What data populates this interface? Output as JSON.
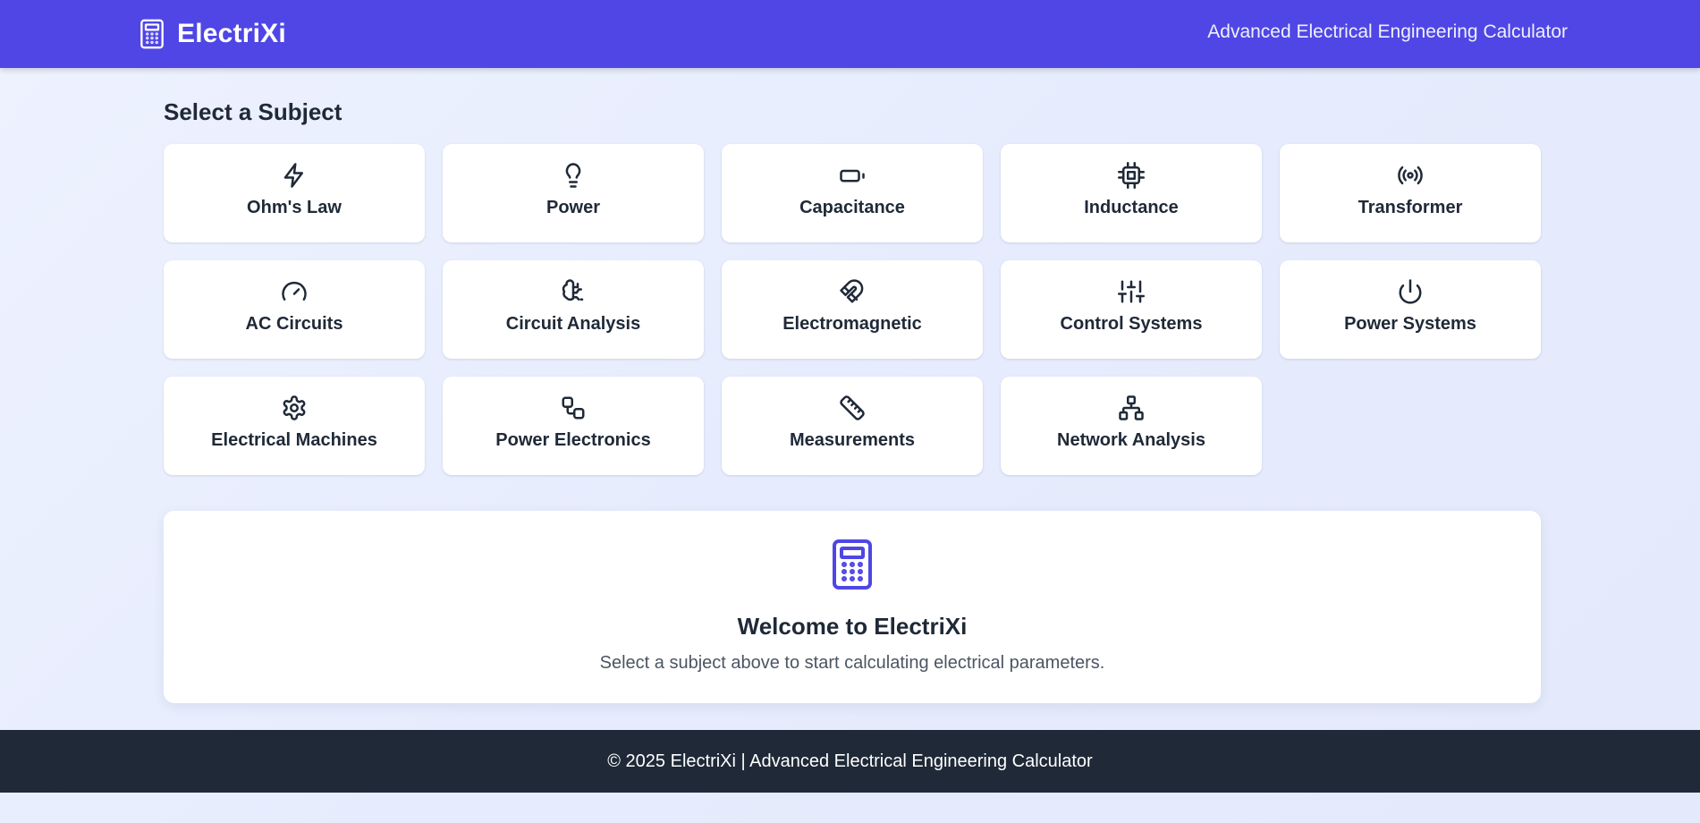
{
  "colors": {
    "primary": "#4f46e5",
    "footer_bg": "#1f2937",
    "text": "#1f2937",
    "muted": "#4b5563"
  },
  "header": {
    "brand_icon": "calculator-icon",
    "brand_name": "ElectriXi",
    "tagline": "Advanced Electrical Engineering Calculator"
  },
  "main": {
    "section_title": "Select a Subject",
    "subjects": [
      {
        "label": "Ohm's Law",
        "icon": "zap-icon"
      },
      {
        "label": "Power",
        "icon": "lightbulb-icon"
      },
      {
        "label": "Capacitance",
        "icon": "battery-icon"
      },
      {
        "label": "Inductance",
        "icon": "cpu-icon"
      },
      {
        "label": "Transformer",
        "icon": "radio-icon"
      },
      {
        "label": "AC Circuits",
        "icon": "gauge-icon"
      },
      {
        "label": "Circuit Analysis",
        "icon": "brain-circuit-icon"
      },
      {
        "label": "Electromagnetic",
        "icon": "magnet-icon"
      },
      {
        "label": "Control Systems",
        "icon": "sliders-icon"
      },
      {
        "label": "Power Systems",
        "icon": "power-icon"
      },
      {
        "label": "Electrical Machines",
        "icon": "gear-icon"
      },
      {
        "label": "Power Electronics",
        "icon": "workflow-icon"
      },
      {
        "label": "Measurements",
        "icon": "ruler-icon"
      },
      {
        "label": "Network Analysis",
        "icon": "network-icon"
      }
    ]
  },
  "welcome": {
    "icon": "calculator-icon",
    "title": "Welcome to ElectriXi",
    "text": "Select a subject above to start calculating electrical parameters."
  },
  "footer": {
    "text": "© 2025 ElectriXi | Advanced Electrical Engineering Calculator"
  }
}
